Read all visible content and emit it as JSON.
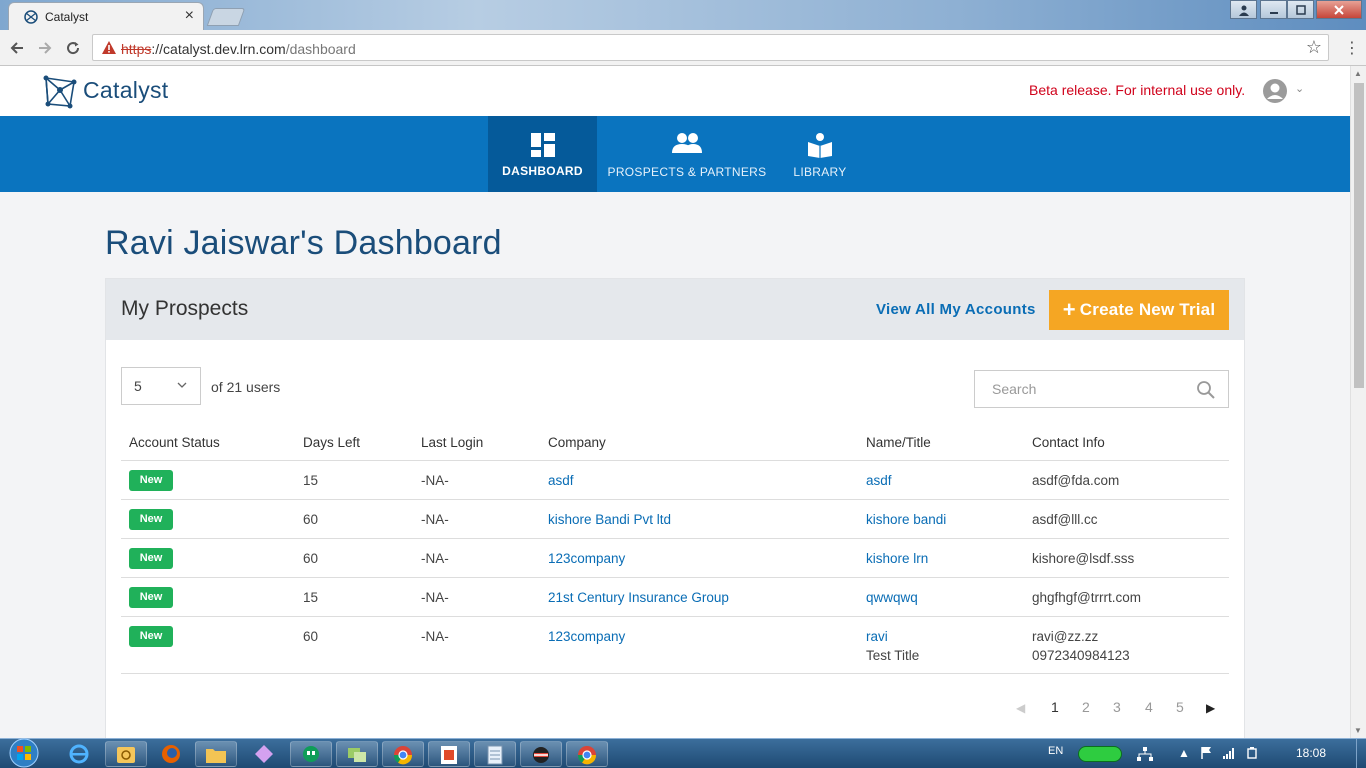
{
  "browser": {
    "tab_title": "Catalyst",
    "tab_close": "×",
    "url_scheme": "https",
    "url_host": "://catalyst.dev.lrn.com",
    "url_path": "/dashboard"
  },
  "header": {
    "brand": "Catalyst",
    "beta_notice": "Beta release. For internal use only."
  },
  "nav": {
    "items": [
      {
        "label": "DASHBOARD",
        "icon": "dashboard-icon"
      },
      {
        "label": "PROSPECTS & PARTNERS",
        "icon": "people-icon"
      },
      {
        "label": "LIBRARY",
        "icon": "book-icon"
      }
    ]
  },
  "page": {
    "title": "Ravi Jaiswar's Dashboard"
  },
  "prospects": {
    "title": "My Prospects",
    "view_all_label": "View All My Accounts",
    "create_label": "Create New Trial",
    "page_size": "5",
    "total_label": "of 21 users",
    "search_placeholder": "Search",
    "columns": [
      "Account Status",
      "Days Left",
      "Last Login",
      "Company",
      "Name/Title",
      "Contact Info"
    ],
    "rows": [
      {
        "status": "New",
        "days_left": "15",
        "last_login": "-NA-",
        "company": "asdf",
        "name": "asdf",
        "title": "",
        "email": "asdf@fda.com",
        "phone": ""
      },
      {
        "status": "New",
        "days_left": "60",
        "last_login": "-NA-",
        "company": "kishore Bandi Pvt ltd",
        "name": "kishore bandi",
        "title": "",
        "email": "asdf@lll.cc",
        "phone": ""
      },
      {
        "status": "New",
        "days_left": "60",
        "last_login": "-NA-",
        "company": "123company",
        "name": "kishore lrn",
        "title": "",
        "email": "kishore@lsdf.sss",
        "phone": ""
      },
      {
        "status": "New",
        "days_left": "15",
        "last_login": "-NA-",
        "company": "21st Century Insurance Group",
        "name": "qwwqwq",
        "title": "",
        "email": "ghgfhgf@trrrt.com",
        "phone": ""
      },
      {
        "status": "New",
        "days_left": "60",
        "last_login": "-NA-",
        "company": "123company",
        "name": "ravi",
        "title": "Test Title",
        "email": "ravi@zz.zz",
        "phone": "0972340984123"
      }
    ],
    "pagination": {
      "pages": [
        "1",
        "2",
        "3",
        "4",
        "5"
      ],
      "current": "1",
      "prev": "◀",
      "next": "▶"
    }
  },
  "taskbar": {
    "language": "EN",
    "clock": "18:08"
  },
  "colors": {
    "nav_bg": "#0a74bf",
    "nav_active_bg": "#055a9a",
    "accent_orange": "#f5a623",
    "badge_green": "#20b15a",
    "link_blue": "#0a6db5",
    "beta_red": "#d0021b"
  }
}
